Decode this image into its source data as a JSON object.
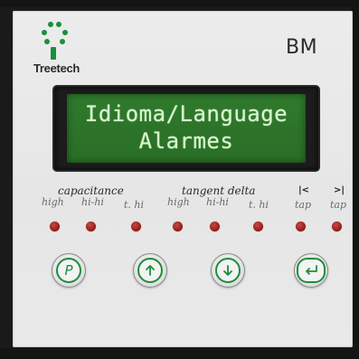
{
  "brand": {
    "name": "Treetech",
    "logo_icon": "treetech-dots-logo",
    "logo_color": "#1b8f3a"
  },
  "model": "BM",
  "display": {
    "line1": "Idioma/Language",
    "line2": "Alarmes",
    "background_color": "#2c732a",
    "text_color": "#d8f5cf"
  },
  "indicators": {
    "groups": {
      "capacitance": "capacitance",
      "tangent_delta": "tangent delta"
    },
    "labels": {
      "cap_high": "high",
      "cap_hihi": "hi-hi",
      "cap_thi": "t. hi",
      "tan_high": "high",
      "tan_hihi": "hi-hi",
      "tan_thi": "t. hi",
      "tap_left": "tap",
      "tap_right": "tap",
      "tap_left_mark": "|<",
      "tap_right_mark": ">|"
    },
    "led_color": "#9a1f1c"
  },
  "keys": {
    "program": {
      "label": "P",
      "icon": "program-p-icon"
    },
    "up": {
      "icon": "arrow-up-icon"
    },
    "down": {
      "icon": "arrow-down-icon"
    },
    "enter": {
      "icon": "enter-return-icon"
    },
    "accent_color": "#1b8f3a"
  }
}
